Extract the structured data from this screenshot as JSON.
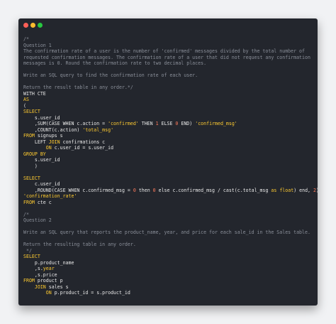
{
  "window": {
    "controls": [
      {
        "name": "close",
        "color": "#fe5f57"
      },
      {
        "name": "minimize",
        "color": "#febc2e"
      },
      {
        "name": "maximize",
        "color": "#28c840"
      }
    ]
  },
  "colors": {
    "background": "#23262d",
    "text": "#e8e8e8",
    "keyword": "#ffcb30",
    "number": "#ff7b5c",
    "comment": "#8a8f99"
  },
  "code_lines": [
    [
      {
        "t": "/*",
        "c": "comment"
      }
    ],
    [
      {
        "t": "Question 1",
        "c": "comment"
      }
    ],
    [
      {
        "t": "The confirmation rate of a user is the number of 'confirmed' messages divided by the total number of",
        "c": "comment"
      }
    ],
    [
      {
        "t": "requested confirmation messages. The confirmation rate of a user that did not request any confirmation",
        "c": "comment"
      }
    ],
    [
      {
        "t": "messages is 0. Round the confirmation rate to two decimal places.",
        "c": "comment"
      }
    ],
    [],
    [
      {
        "t": "Write an SQL query to find the confirmation rate of each user.",
        "c": "comment"
      }
    ],
    [],
    [
      {
        "t": "Return the result table in any order.*/",
        "c": "comment"
      }
    ],
    [
      {
        "t": "WITH CTE",
        "c": "plain"
      }
    ],
    [
      {
        "t": "AS",
        "c": "kw"
      }
    ],
    [
      {
        "t": "(",
        "c": "plain"
      }
    ],
    [
      {
        "t": "SELECT",
        "c": "kw"
      }
    ],
    [
      {
        "t": "    s.user_id",
        "c": "plain"
      }
    ],
    [
      {
        "t": "    ,SUM(CASE WHEN c.action = ",
        "c": "plain"
      },
      {
        "t": "'confirmed'",
        "c": "str"
      },
      {
        "t": " THEN ",
        "c": "plain"
      },
      {
        "t": "1",
        "c": "num"
      },
      {
        "t": " ELSE ",
        "c": "plain"
      },
      {
        "t": "0",
        "c": "num"
      },
      {
        "t": " END) ",
        "c": "plain"
      },
      {
        "t": "'confirmed_msg'",
        "c": "str"
      }
    ],
    [
      {
        "t": "    ,COUNT(c.action) ",
        "c": "plain"
      },
      {
        "t": "'total_msg'",
        "c": "str"
      }
    ],
    [
      {
        "t": "FROM",
        "c": "kw"
      },
      {
        "t": " signups s",
        "c": "plain"
      }
    ],
    [
      {
        "t": "    LEFT ",
        "c": "plain"
      },
      {
        "t": "JOIN",
        "c": "kw"
      },
      {
        "t": " confirmations c",
        "c": "plain"
      }
    ],
    [
      {
        "t": "        ",
        "c": "plain"
      },
      {
        "t": "ON",
        "c": "kw"
      },
      {
        "t": " c.user_id = s.user_id",
        "c": "plain"
      }
    ],
    [
      {
        "t": "GROUP BY",
        "c": "kw"
      }
    ],
    [
      {
        "t": "    s.user_id",
        "c": "plain"
      }
    ],
    [
      {
        "t": "    )",
        "c": "plain"
      }
    ],
    [],
    [
      {
        "t": "SELECT",
        "c": "kw"
      }
    ],
    [
      {
        "t": "    c.user_id",
        "c": "plain"
      }
    ],
    [
      {
        "t": "    ,ROUND(CASE WHEN c.confirmed_msg = ",
        "c": "plain"
      },
      {
        "t": "0",
        "c": "num"
      },
      {
        "t": " then ",
        "c": "plain"
      },
      {
        "t": "0",
        "c": "num"
      },
      {
        "t": " else c.confirmed_msg / cast(c.total_msg ",
        "c": "plain"
      },
      {
        "t": "as",
        "c": "kw"
      },
      {
        "t": " ",
        "c": "plain"
      },
      {
        "t": "float",
        "c": "kw"
      },
      {
        "t": ") end, ",
        "c": "plain"
      },
      {
        "t": "2",
        "c": "num"
      },
      {
        "t": ")",
        "c": "plain"
      }
    ],
    [
      {
        "t": "'confirmation_rate'",
        "c": "str"
      }
    ],
    [
      {
        "t": "FROM",
        "c": "kw"
      },
      {
        "t": " cte c",
        "c": "plain"
      }
    ],
    [],
    [
      {
        "t": "/*",
        "c": "comment"
      }
    ],
    [
      {
        "t": "Question 2",
        "c": "comment"
      }
    ],
    [],
    [
      {
        "t": "Write an SQL query that reports the product_name, year, and price for each sale_id in the Sales table.",
        "c": "comment"
      }
    ],
    [],
    [
      {
        "t": "Return the resulting table in any order.",
        "c": "comment"
      }
    ],
    [
      {
        "t": " */",
        "c": "comment"
      }
    ],
    [
      {
        "t": "SELECT",
        "c": "kw"
      }
    ],
    [
      {
        "t": "    p.product_name",
        "c": "plain"
      }
    ],
    [
      {
        "t": "    ,s.",
        "c": "plain"
      },
      {
        "t": "year",
        "c": "kw"
      }
    ],
    [
      {
        "t": "    ,s.price",
        "c": "plain"
      }
    ],
    [
      {
        "t": "FROM",
        "c": "kw"
      },
      {
        "t": " product p",
        "c": "plain"
      }
    ],
    [
      {
        "t": "    ",
        "c": "plain"
      },
      {
        "t": "JOIN",
        "c": "kw"
      },
      {
        "t": " sales s",
        "c": "plain"
      }
    ],
    [
      {
        "t": "        ",
        "c": "plain"
      },
      {
        "t": "ON",
        "c": "kw"
      },
      {
        "t": " p.product_id = s.product_id",
        "c": "plain"
      }
    ]
  ]
}
